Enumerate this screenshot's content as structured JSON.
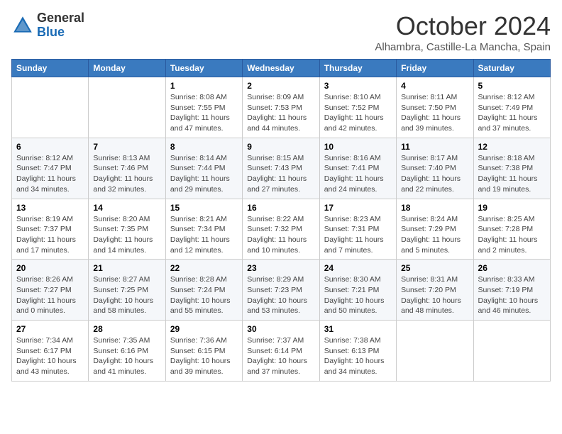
{
  "header": {
    "logo_general": "General",
    "logo_blue": "Blue",
    "month_title": "October 2024",
    "location": "Alhambra, Castille-La Mancha, Spain"
  },
  "days_of_week": [
    "Sunday",
    "Monday",
    "Tuesday",
    "Wednesday",
    "Thursday",
    "Friday",
    "Saturday"
  ],
  "weeks": [
    [
      {
        "day": "",
        "info": ""
      },
      {
        "day": "",
        "info": ""
      },
      {
        "day": "1",
        "info": "Sunrise: 8:08 AM\nSunset: 7:55 PM\nDaylight: 11 hours and 47 minutes."
      },
      {
        "day": "2",
        "info": "Sunrise: 8:09 AM\nSunset: 7:53 PM\nDaylight: 11 hours and 44 minutes."
      },
      {
        "day": "3",
        "info": "Sunrise: 8:10 AM\nSunset: 7:52 PM\nDaylight: 11 hours and 42 minutes."
      },
      {
        "day": "4",
        "info": "Sunrise: 8:11 AM\nSunset: 7:50 PM\nDaylight: 11 hours and 39 minutes."
      },
      {
        "day": "5",
        "info": "Sunrise: 8:12 AM\nSunset: 7:49 PM\nDaylight: 11 hours and 37 minutes."
      }
    ],
    [
      {
        "day": "6",
        "info": "Sunrise: 8:12 AM\nSunset: 7:47 PM\nDaylight: 11 hours and 34 minutes."
      },
      {
        "day": "7",
        "info": "Sunrise: 8:13 AM\nSunset: 7:46 PM\nDaylight: 11 hours and 32 minutes."
      },
      {
        "day": "8",
        "info": "Sunrise: 8:14 AM\nSunset: 7:44 PM\nDaylight: 11 hours and 29 minutes."
      },
      {
        "day": "9",
        "info": "Sunrise: 8:15 AM\nSunset: 7:43 PM\nDaylight: 11 hours and 27 minutes."
      },
      {
        "day": "10",
        "info": "Sunrise: 8:16 AM\nSunset: 7:41 PM\nDaylight: 11 hours and 24 minutes."
      },
      {
        "day": "11",
        "info": "Sunrise: 8:17 AM\nSunset: 7:40 PM\nDaylight: 11 hours and 22 minutes."
      },
      {
        "day": "12",
        "info": "Sunrise: 8:18 AM\nSunset: 7:38 PM\nDaylight: 11 hours and 19 minutes."
      }
    ],
    [
      {
        "day": "13",
        "info": "Sunrise: 8:19 AM\nSunset: 7:37 PM\nDaylight: 11 hours and 17 minutes."
      },
      {
        "day": "14",
        "info": "Sunrise: 8:20 AM\nSunset: 7:35 PM\nDaylight: 11 hours and 14 minutes."
      },
      {
        "day": "15",
        "info": "Sunrise: 8:21 AM\nSunset: 7:34 PM\nDaylight: 11 hours and 12 minutes."
      },
      {
        "day": "16",
        "info": "Sunrise: 8:22 AM\nSunset: 7:32 PM\nDaylight: 11 hours and 10 minutes."
      },
      {
        "day": "17",
        "info": "Sunrise: 8:23 AM\nSunset: 7:31 PM\nDaylight: 11 hours and 7 minutes."
      },
      {
        "day": "18",
        "info": "Sunrise: 8:24 AM\nSunset: 7:29 PM\nDaylight: 11 hours and 5 minutes."
      },
      {
        "day": "19",
        "info": "Sunrise: 8:25 AM\nSunset: 7:28 PM\nDaylight: 11 hours and 2 minutes."
      }
    ],
    [
      {
        "day": "20",
        "info": "Sunrise: 8:26 AM\nSunset: 7:27 PM\nDaylight: 11 hours and 0 minutes."
      },
      {
        "day": "21",
        "info": "Sunrise: 8:27 AM\nSunset: 7:25 PM\nDaylight: 10 hours and 58 minutes."
      },
      {
        "day": "22",
        "info": "Sunrise: 8:28 AM\nSunset: 7:24 PM\nDaylight: 10 hours and 55 minutes."
      },
      {
        "day": "23",
        "info": "Sunrise: 8:29 AM\nSunset: 7:23 PM\nDaylight: 10 hours and 53 minutes."
      },
      {
        "day": "24",
        "info": "Sunrise: 8:30 AM\nSunset: 7:21 PM\nDaylight: 10 hours and 50 minutes."
      },
      {
        "day": "25",
        "info": "Sunrise: 8:31 AM\nSunset: 7:20 PM\nDaylight: 10 hours and 48 minutes."
      },
      {
        "day": "26",
        "info": "Sunrise: 8:33 AM\nSunset: 7:19 PM\nDaylight: 10 hours and 46 minutes."
      }
    ],
    [
      {
        "day": "27",
        "info": "Sunrise: 7:34 AM\nSunset: 6:17 PM\nDaylight: 10 hours and 43 minutes."
      },
      {
        "day": "28",
        "info": "Sunrise: 7:35 AM\nSunset: 6:16 PM\nDaylight: 10 hours and 41 minutes."
      },
      {
        "day": "29",
        "info": "Sunrise: 7:36 AM\nSunset: 6:15 PM\nDaylight: 10 hours and 39 minutes."
      },
      {
        "day": "30",
        "info": "Sunrise: 7:37 AM\nSunset: 6:14 PM\nDaylight: 10 hours and 37 minutes."
      },
      {
        "day": "31",
        "info": "Sunrise: 7:38 AM\nSunset: 6:13 PM\nDaylight: 10 hours and 34 minutes."
      },
      {
        "day": "",
        "info": ""
      },
      {
        "day": "",
        "info": ""
      }
    ]
  ]
}
